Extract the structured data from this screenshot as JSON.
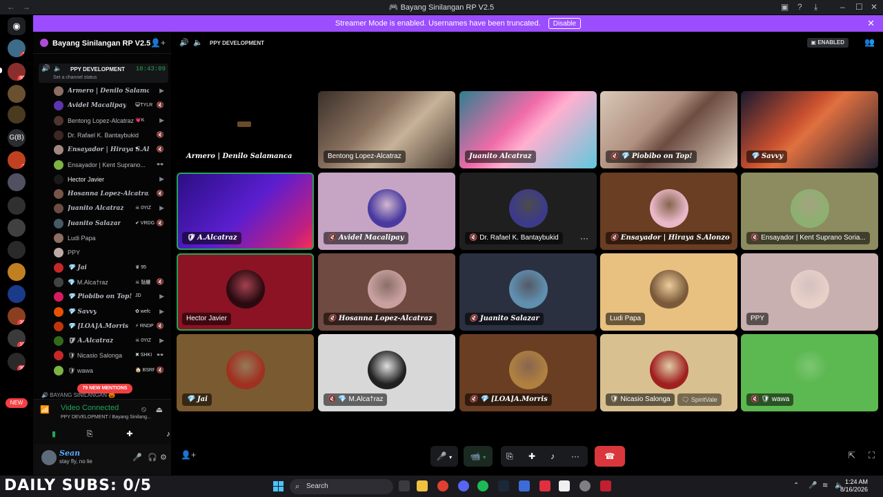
{
  "window": {
    "title": "Bayang Sinilangan RP V2.5",
    "back": "←",
    "forward": "→"
  },
  "banner": {
    "text": "Streamer Mode is enabled. Usernames have been truncated.",
    "button": "Disable",
    "close": "✕"
  },
  "guilds": {
    "badges": [
      "1",
      "80",
      "3",
      "38",
      "10",
      "90"
    ],
    "text_guild": "G(B)",
    "new_label": "NEW"
  },
  "server": {
    "name": "Bayang Sinilangan RP V2.5",
    "chevron": "▾"
  },
  "channel": {
    "name": "PPY DEVELOPMENT",
    "time": "10:43:09",
    "status": "Set a channel status"
  },
  "voice_users": [
    {
      "name": "Armero | Denilo Salamanca",
      "fancy": true,
      "color": "#8d6e63",
      "icon": "▶"
    },
    {
      "name": "Avidel Macalipay",
      "tag": "😺TYLR",
      "fancy": true,
      "color": "#5e35b1",
      "icon": "🔇"
    },
    {
      "name": "Bentong Lopez-Alcatraz",
      "tag": "💗K",
      "fancy": false,
      "color": "#4e342e",
      "icon": "▶"
    },
    {
      "name": "Dr. Rafael K. Bantaybukid",
      "fancy": false,
      "color": "#3e2723",
      "icon": "🔇"
    },
    {
      "name": "Ensayador | Hiraya S.Alonzo",
      "tag": "♥",
      "fancy": true,
      "color": "#a1887f",
      "icon": "🔇"
    },
    {
      "name": "Ensayador | Kent Suprano...",
      "fancy": false,
      "color": "#7cb342",
      "icon": "👓"
    },
    {
      "name": "Hector Javier",
      "fancy": false,
      "color": "#1a1a1a",
      "icon": "▶",
      "bright": true
    },
    {
      "name": "Hosanna Lopez-Alcatraz",
      "fancy": true,
      "color": "#795548",
      "icon": "🔇"
    },
    {
      "name": "Juanito Alcatraz",
      "tag": "☠ 0YIZ",
      "fancy": true,
      "color": "#6d4c41",
      "icon": "▶"
    },
    {
      "name": "Juanito Salazar",
      "tag": "✔ VRDG",
      "fancy": true,
      "color": "#455a64",
      "icon": "🔇"
    },
    {
      "name": "Ludi Papa",
      "fancy": false,
      "color": "#8d6e63",
      "icon": ""
    },
    {
      "name": "PPY",
      "fancy": false,
      "color": "#bcaaa4",
      "icon": ""
    },
    {
      "name": "💎 Jai",
      "tag": "♛ 95",
      "fancy": true,
      "color": "#c62828",
      "icon": ""
    },
    {
      "name": "💎 M.Alca†raz",
      "tag": "☠ 骷髏",
      "fancy": false,
      "color": "#424242",
      "icon": "🔇"
    },
    {
      "name": "💎 Piobibo on Top!",
      "tag": "JD",
      "fancy": true,
      "color": "#d81b60",
      "icon": "▶"
    },
    {
      "name": "💎 Savvy",
      "tag": "✿ wefc",
      "fancy": true,
      "color": "#e65100",
      "icon": "▶"
    },
    {
      "name": "💎 [LOA]A.Morris",
      "tag": "⚡ RNDP",
      "fancy": true,
      "color": "#bf360c",
      "icon": "🔇"
    },
    {
      "name": "🛡 A.Alcatraz",
      "tag": "☠ 0YIZ",
      "fancy": true,
      "color": "#33691e",
      "icon": "▶"
    },
    {
      "name": "🛡 Nicasio Salonga",
      "tag": "✖ SHKI",
      "fancy": false,
      "color": "#c62828",
      "icon": "👓"
    },
    {
      "name": "🛡 wawa",
      "tag": "🏠 BSRP",
      "fancy": false,
      "color": "#7cb342",
      "icon": "🔇"
    }
  ],
  "mentions": "79 NEW MENTIONS",
  "next_category": "BAYANG SINILANGAN 🎃",
  "rtc": {
    "status": "Video Connected",
    "sub": "PPY DEVELOPMENT / Bayang Sinilang..."
  },
  "user": {
    "name": "Sean",
    "status": "stay fly, no lie"
  },
  "main_header": {
    "channel": "PPY DEVELOPMENT",
    "streamer": "ENABLED"
  },
  "tiles": [
    {
      "label": "Armero | Denilo Salamanca",
      "fancy": true,
      "bg": "#000000",
      "row": 0,
      "col": 0,
      "type": "empty"
    },
    {
      "label": "Bentong Lopez-Alcatraz",
      "fancy": false,
      "bg": "#5a4a3e",
      "row": 0,
      "col": 1,
      "type": "video",
      "grad": "linear-gradient(135deg,#3b3028 0%,#8a7260 40%,#c7b299 60%,#4a3a30 100%)"
    },
    {
      "label": "Juanito Alcatraz",
      "fancy": true,
      "bg": "#4fb3c8",
      "row": 0,
      "col": 2,
      "type": "video",
      "grad": "linear-gradient(135deg,#2f7f90 0%,#f06ba8 40%,#ffb0d0 55%,#5fc8dc 100%)"
    },
    {
      "label": "🔇 💎 Piobibo on Top!",
      "fancy": true,
      "bg": "#c9b8a8",
      "row": 0,
      "col": 3,
      "type": "video",
      "grad": "linear-gradient(135deg,#d9c8b8 0%,#b09080 40%,#6d4c41 55%,#e0d0c0 100%)"
    },
    {
      "label": "💎 Savvy",
      "fancy": true,
      "bg": "#2a1a20",
      "row": 0,
      "col": 4,
      "type": "video",
      "grad": "linear-gradient(135deg,#1a1a30 0%,#c84f2f 40%,#e07040 50%,#202030 100%)"
    },
    {
      "label": "🛡 A.Alcatraz",
      "fancy": true,
      "bg": "#3a10a0",
      "row": 1,
      "col": 0,
      "type": "video",
      "grad": "linear-gradient(135deg,#2a0e80 0%,#5a1ed0 50%,#c02080 85%,#ff3050 100%)",
      "speaking": true
    },
    {
      "label": "🔇 Avidel Macalipay",
      "fancy": true,
      "bg": "#c6a5c4",
      "row": 1,
      "col": 1,
      "type": "avatar",
      "avc": "#4a3aa0"
    },
    {
      "label": "🔇 Dr. Rafael K. Bantaybukid",
      "fancy": false,
      "bg": "#1f1f1f",
      "row": 1,
      "col": 2,
      "type": "avatar",
      "avc": "#3d3a8a",
      "more": "···"
    },
    {
      "label": "🔇 Ensayador | Hiraya S.Alonzo",
      "fancy": true,
      "bg": "#6a3e22",
      "row": 1,
      "col": 3,
      "type": "avatar",
      "avc": "#e8b8c8"
    },
    {
      "label": "🔇 Ensayador | Kent Suprano Soria...",
      "fancy": false,
      "bg": "#8c8c60",
      "row": 1,
      "col": 4,
      "type": "avatar",
      "avc": "#8db070"
    },
    {
      "label": "Hector Javier",
      "fancy": false,
      "bg": "#8c1324",
      "row": 2,
      "col": 0,
      "type": "avatar",
      "avc": "#2a0a10",
      "speaking": true
    },
    {
      "label": "🔇 Hosanna Lopez-Alcatraz",
      "fancy": true,
      "bg": "#6e4a40",
      "row": 2,
      "col": 1,
      "type": "avatar",
      "avc": "#c8a0a0"
    },
    {
      "label": "🔇 Juanito Salazar",
      "fancy": true,
      "bg": "#2a3040",
      "row": 2,
      "col": 2,
      "type": "avatar",
      "avc": "#6090b0"
    },
    {
      "label": "Ludi Papa",
      "fancy": false,
      "bg": "#e8c080",
      "row": 2,
      "col": 3,
      "type": "avatar",
      "avc": "#7a5a3a"
    },
    {
      "label": "PPY",
      "fancy": false,
      "bg": "#c8b0b0",
      "row": 2,
      "col": 4,
      "type": "avatar",
      "avc": "#e8d0c8"
    },
    {
      "label": "💎 Jai",
      "fancy": true,
      "bg": "#7a5a30",
      "row": 3,
      "col": 0,
      "type": "avatar",
      "avc": "#a03020"
    },
    {
      "label": "🔇 💎 M.Alca†raz",
      "fancy": false,
      "bg": "#d8d8d8",
      "row": 3,
      "col": 1,
      "type": "avatar",
      "avc": "#202020"
    },
    {
      "label": "🔇 💎 [LOA]A.Morris",
      "fancy": true,
      "bg": "#6a3e22",
      "row": 3,
      "col": 2,
      "type": "avatar",
      "avc": "#b08040"
    },
    {
      "label": "🛡 Nicasio Salonga",
      "fancy": false,
      "bg": "#d8c090",
      "row": 3,
      "col": 3,
      "type": "avatar",
      "avc": "#a02020",
      "extra": "🗨 SpiritVale"
    },
    {
      "label": "🔇 🛡 wawa",
      "fancy": false,
      "bg": "#5cb850",
      "row": 3,
      "col": 4,
      "type": "avatar",
      "avc": "#5cb850"
    }
  ],
  "controls": {
    "mic": "🎤",
    "cam": "📹",
    "share": "⎘",
    "activity": "✚",
    "soundboard": "♪",
    "more": "···",
    "end": "☎"
  },
  "taskbar": {
    "overlay": "DAILY SUBS: 0/5",
    "search": "Search",
    "time": "1:24 AM",
    "date": "8/16/2026"
  },
  "colors": {
    "accent": "#9b4dff",
    "green": "#23a55a",
    "red": "#da373c"
  }
}
